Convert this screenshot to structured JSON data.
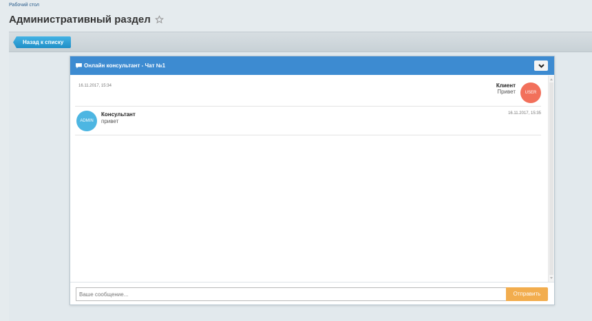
{
  "breadcrumb": {
    "label": "Рабочий стол"
  },
  "page": {
    "title": "Административный раздел"
  },
  "toolbar": {
    "back_label": "Назад к списку"
  },
  "chat": {
    "title": "Онлайн консультант - Чат №1",
    "messages": [
      {
        "time": "16.11.2017, 15:34",
        "author": "Клиент",
        "text": "Привет",
        "avatar": "USER"
      },
      {
        "time": "16.11.2017, 15:35",
        "author": "Консультант",
        "text": "привет",
        "avatar": "ADMIN"
      }
    ],
    "input_placeholder": "Ваше сообщение...",
    "input_value": "",
    "send_label": "Отправить"
  },
  "colors": {
    "header": "#3d8bd1",
    "back_button": "#2a9bd4",
    "user_avatar": "#f2705b",
    "admin_avatar": "#4db6e2",
    "send_button": "#f2ad4e"
  },
  "icons": {
    "star": "star-icon",
    "chat": "chat-bubble-icon",
    "collapse": "chevron-down-icon"
  }
}
